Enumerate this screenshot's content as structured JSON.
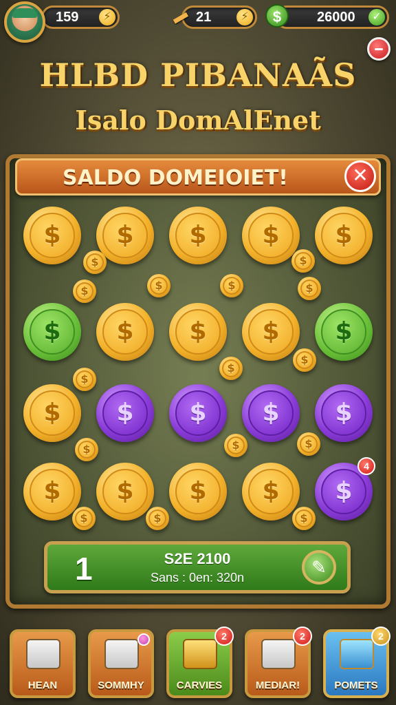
{
  "hud": {
    "coins": "159",
    "tickets": "21",
    "cash": "26000",
    "coin_icon": "lightning-coin-icon",
    "ticket_icon": "ticket-icon",
    "cash_icon": "dollar-badge-icon",
    "check_icon": "check-icon",
    "dollar_glyph": "$",
    "bolt_glyph": "⚡",
    "check_glyph": "✓"
  },
  "title": {
    "main": "HLBD PIBANAÃS",
    "sub": "Isalo DomAlEnet"
  },
  "board": {
    "banner_text": "SALDO DOMEIOIET!",
    "close_glyph": "✕",
    "coin_symbol": "$",
    "purple_badge": "4"
  },
  "score": {
    "number": "1",
    "line1": "S2E 2100",
    "line2": "Sans : 0en: 320n",
    "button_glyph": "✎"
  },
  "nav": [
    {
      "label": "HEAN",
      "badge": ""
    },
    {
      "label": "SOMMHY",
      "badge": ""
    },
    {
      "label": "CARVIES",
      "badge": "2"
    },
    {
      "label": "MEDIAR!",
      "badge": "2"
    },
    {
      "label": "POMETS",
      "badge": "2"
    }
  ],
  "colors": {
    "gold": "#f4b22a",
    "green": "#6cc23a",
    "purple": "#8a3cd8",
    "banner": "#d0702a",
    "score_bar": "#4a9a2a"
  }
}
